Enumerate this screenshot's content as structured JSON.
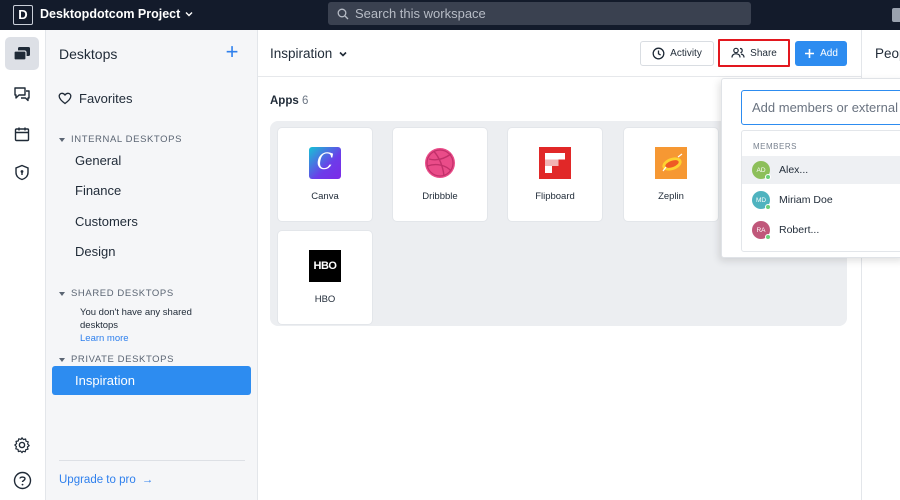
{
  "topbar": {
    "logo_letter": "D",
    "project_name": "Desktopdotcom Project",
    "search_placeholder": "Search this workspace"
  },
  "rail": {
    "icons": [
      "desktops-icon",
      "chat-icon",
      "calendar-icon",
      "shield-icon",
      "settings-icon",
      "help-icon"
    ]
  },
  "sidebar": {
    "title": "Desktops",
    "add_label": "+",
    "favorites": "Favorites",
    "internal_title": "INTERNAL DESKTOPS",
    "internal_items": [
      "General",
      "Finance",
      "Customers",
      "Design"
    ],
    "shared_title": "SHARED DESKTOPS",
    "shared_note": "You don't have any shared desktops",
    "learn_more": "Learn more",
    "private_title": "PRIVATE DESKTOPS",
    "private_active": "Inspiration",
    "upgrade": "Upgrade to pro",
    "upgrade_arrow": "→"
  },
  "main": {
    "title": "Inspiration",
    "activity_label": "Activity",
    "share_label": "Share",
    "add_label": "Add",
    "apps_label": "Apps",
    "apps_count": "6",
    "apps": [
      {
        "name": "Canva",
        "icon": "canva-icon",
        "color": "#7d2ae8"
      },
      {
        "name": "Dribbble",
        "icon": "dribbble-icon",
        "color": "#ea4c89"
      },
      {
        "name": "Flipboard",
        "icon": "flipboard-icon",
        "color": "#e12828"
      },
      {
        "name": "Zeplin",
        "icon": "zeplin-icon",
        "color": "#f69833"
      },
      {
        "name": "HBO",
        "icon": "hbo-icon",
        "color": "#000000"
      }
    ]
  },
  "right_panel": {
    "title": "Peop"
  },
  "share_popup": {
    "input_placeholder": "Add members or external",
    "members_label": "MEMBERS",
    "members": [
      {
        "initials": "AD",
        "name": "Alex...",
        "color": "#8dbf5a"
      },
      {
        "initials": "MD",
        "name": "Miriam Doe",
        "color": "#4fb3bf"
      },
      {
        "initials": "RA",
        "name": "Robert...",
        "color": "#c0577a"
      }
    ]
  },
  "colors": {
    "accent": "#2d8cf0",
    "topbar": "#131b2b",
    "share_highlight": "#e2171e"
  }
}
